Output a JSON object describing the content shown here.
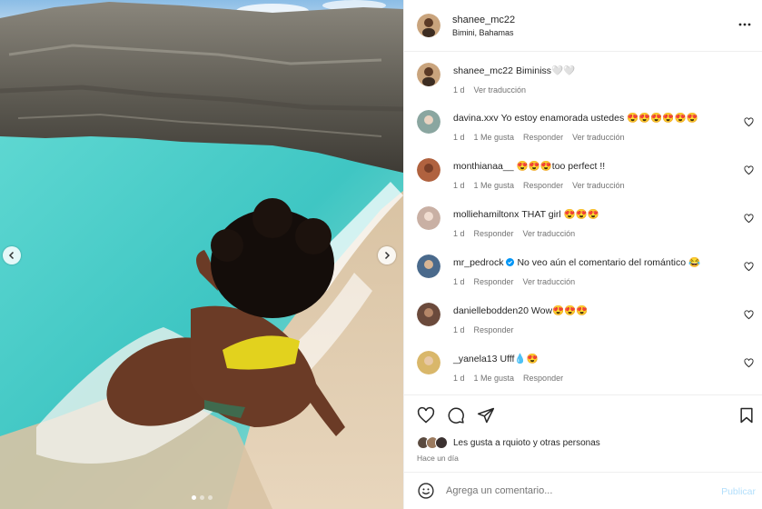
{
  "post": {
    "username": "shanee_mc22",
    "location": "Bimini, Bahamas",
    "caption": "Biminiss🤍🤍",
    "caption_time": "1 d",
    "caption_translate": "Ver traducción"
  },
  "comments": [
    {
      "user": "davina.xxv",
      "text": "Yo estoy enamorada ustedes 😍😍😍😍😍😍",
      "time": "1 d",
      "likes": "1 Me gusta",
      "reply": "Responder",
      "translate": "Ver traducción",
      "verified": false,
      "avatar_color": "#8aa6a0"
    },
    {
      "user": "monthianaa__",
      "text": "😍😍😍too perfect !!",
      "time": "1 d",
      "likes": "1 Me gusta",
      "reply": "Responder",
      "translate": "Ver traducción",
      "verified": false,
      "avatar_color": "#b0623f"
    },
    {
      "user": "molliehamiltonx",
      "text": "THAT girl 😍😍😍",
      "time": "1 d",
      "likes": "",
      "reply": "Responder",
      "translate": "Ver traducción",
      "verified": false,
      "avatar_color": "#c9b0a4"
    },
    {
      "user": "mr_pedrock",
      "text": "No veo aún el comentario del romántico 😂",
      "time": "1 d",
      "likes": "",
      "reply": "Responder",
      "translate": "Ver traducción",
      "verified": true,
      "avatar_color": "#4a6a8c"
    },
    {
      "user": "daniellebodden20",
      "text": "Wow😍😍😍",
      "time": "1 d",
      "likes": "",
      "reply": "Responder",
      "translate": "",
      "verified": false,
      "avatar_color": "#6b4a3c"
    },
    {
      "user": "_yanela13",
      "text": "Ufff💧😍",
      "time": "1 d",
      "likes": "1 Me gusta",
      "reply": "Responder",
      "translate": "",
      "verified": false,
      "avatar_color": "#d9b76a"
    }
  ],
  "actions": {
    "liked_by_prefix": "Les gusta a ",
    "liked_by_user": "rquioto",
    "liked_by_suffix": " y otras personas",
    "posted_ago": "Hace un día"
  },
  "add_comment": {
    "placeholder": "Agrega un comentario...",
    "post_label": "Publicar"
  },
  "icons": {
    "more": "more-horizontal-icon",
    "like": "heart-icon",
    "comment": "comment-icon",
    "share": "paper-plane-icon",
    "save": "bookmark-icon",
    "emoji": "smiley-icon",
    "prev": "chevron-left-icon",
    "next": "chevron-right-icon",
    "verified": "verified-badge-icon"
  },
  "colors": {
    "text": "#262626",
    "secondary": "#737373",
    "link_disabled": "#b2dffc",
    "verified": "#0095f6",
    "water": "#3fc6c3",
    "sand": "#e2cdb1",
    "rock": "#6d6a62",
    "swimsuit": "#e2d21e"
  },
  "carousel": {
    "slide_count": 3,
    "active_slide": 1
  }
}
